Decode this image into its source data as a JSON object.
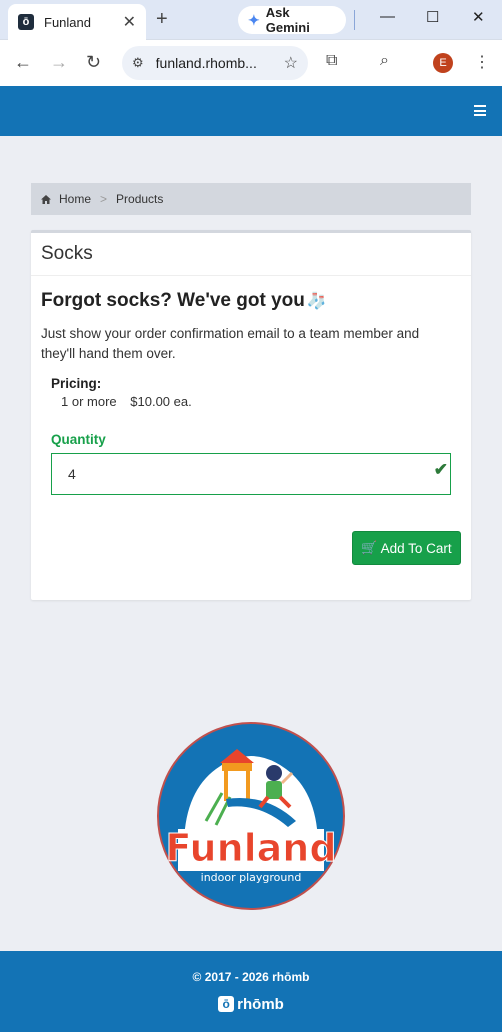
{
  "browser": {
    "tab_title": "Funland",
    "tab_favicon": "ō",
    "new_tab_label": "+",
    "gemini_label": "Ask Gemini",
    "url": "funland.rhomb...",
    "profile_initial": "E"
  },
  "breadcrumb": {
    "home": "Home",
    "separator": ">",
    "current": "Products"
  },
  "product": {
    "title": "Socks",
    "headline": "Forgot socks? We've got you",
    "headline_emoji": "🧦",
    "description": "Just show your order confirmation email to a team member and they'll hand them over.",
    "pricing_label": "Pricing:",
    "pricing_qty": "1 or more",
    "pricing_price": "$10.00 ea.",
    "quantity_label": "Quantity",
    "quantity_value": "4",
    "add_to_cart_label": "Add To Cart"
  },
  "logo": {
    "brand": "Funland",
    "tagline": "indoor playground"
  },
  "footer": {
    "copyright": "© 2017 - 2026 rhōmb",
    "logo_text": "rhōmb"
  },
  "colors": {
    "brand_blue": "#1373b5",
    "success_green": "#17a04a"
  }
}
